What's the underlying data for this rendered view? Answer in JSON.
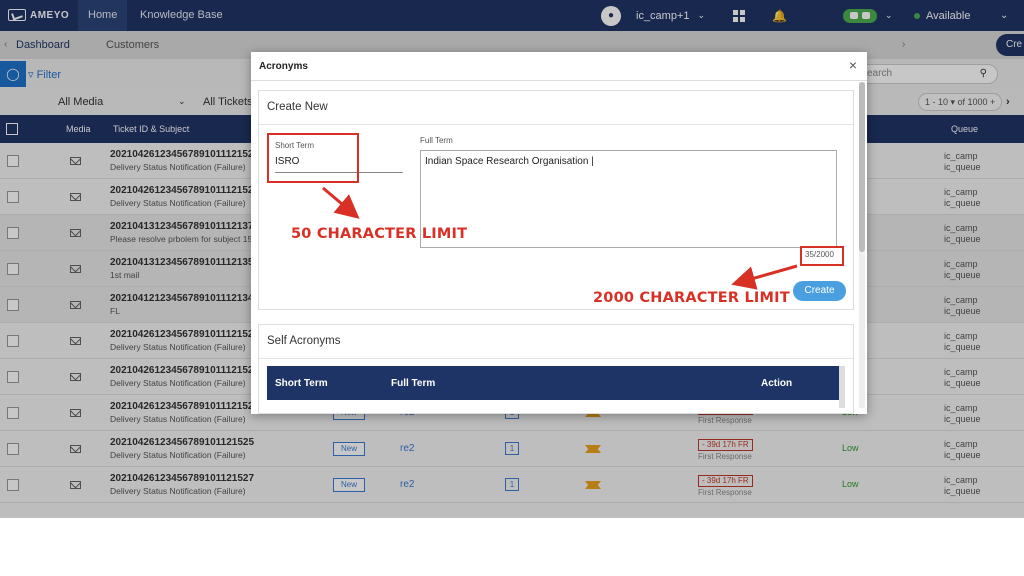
{
  "topbar": {
    "logo_text": "AMEYO",
    "tabs": [
      "Home",
      "Knowledge Base"
    ],
    "campaign": "ic_camp+1",
    "status": "Available",
    "icons": [
      "chat-bubble-icon",
      "chevron-down-icon",
      "grid-icon",
      "bell-icon",
      "chevron-down-icon"
    ]
  },
  "subbar": {
    "tabs": [
      "Dashboard",
      "Customers"
    ],
    "create_partial": "Cre"
  },
  "filterbar": {
    "filter_label": "Filter",
    "search_placeholder": "earch"
  },
  "mediarow": {
    "media_select": "All Media",
    "tickets_select": "All Tickets",
    "pagination": "1 - 10 ▾ of 1000 +"
  },
  "table": {
    "headers": {
      "media": "Media",
      "ticket": "Ticket ID & Subject",
      "queue": "Queue"
    },
    "rows": [
      {
        "id": "20210426123456789101112152",
        "subject": "Delivery Status Notification (Failure)",
        "queue1": "ic_camp",
        "queue2": "ic_queue"
      },
      {
        "id": "20210426123456789101112152",
        "subject": "Delivery Status Notification (Failure)",
        "queue1": "ic_camp",
        "queue2": "ic_queue"
      },
      {
        "id": "20210413123456789101112137",
        "subject": "Please resolve prbolem for subject 15",
        "queue1": "ic_camp",
        "queue2": "ic_queue"
      },
      {
        "id": "20210413123456789101112135",
        "subject": "1st mail",
        "queue1": "ic_camp",
        "queue2": "ic_queue"
      },
      {
        "id": "20210412123456789101112134",
        "subject": "FL",
        "queue1": "ic_camp",
        "queue2": "ic_queue"
      },
      {
        "id": "20210426123456789101112152",
        "subject": "Delivery Status Notification (Failure)",
        "queue1": "ic_camp",
        "queue2": "ic_queue"
      },
      {
        "id": "20210426123456789101112152",
        "subject": "Delivery Status Notification (Failure)",
        "queue1": "ic_camp",
        "queue2": "ic_queue"
      },
      {
        "id": "20210426123456789101112152",
        "subject": "Delivery Status Notification (Failure)",
        "status": "New",
        "assignee": "re2",
        "count": "1",
        "sla": "- 39d 17h FR",
        "sla_sub": "First Response",
        "priority": "Low",
        "queue1": "ic_camp",
        "queue2": "ic_queue"
      },
      {
        "id": "20210426123456789101121525",
        "subject": "Delivery Status Notification (Failure)",
        "status": "New",
        "assignee": "re2",
        "count": "1",
        "sla": "- 39d 17h FR",
        "sla_sub": "First Response",
        "priority": "Low",
        "queue1": "ic_camp",
        "queue2": "ic_queue"
      },
      {
        "id": "20210426123456789101121527",
        "subject": "Delivery Status Notification (Failure)",
        "status": "New",
        "assignee": "re2",
        "count": "1",
        "sla": "- 39d 17h FR",
        "sla_sub": "First Response",
        "priority": "Low",
        "queue1": "ic_camp",
        "queue2": "ic_queue"
      }
    ]
  },
  "modal": {
    "title": "Acronyms",
    "close": "×",
    "create_section": {
      "heading": "Create New",
      "short_term_label": "Short Term",
      "short_term_value": "ISRO",
      "full_term_label": "Full Term",
      "full_term_value": "Indian Space Research Organisation |",
      "counter": "35/2000",
      "create_button": "Create"
    },
    "self_section": {
      "heading": "Self Acronyms",
      "columns": [
        "Short Term",
        "Full Term",
        "Action"
      ]
    }
  },
  "annotations": {
    "short_limit": "50 CHARACTER LIMIT",
    "full_limit": "2000 CHARACTER LIMIT",
    "color": "#d93025"
  }
}
